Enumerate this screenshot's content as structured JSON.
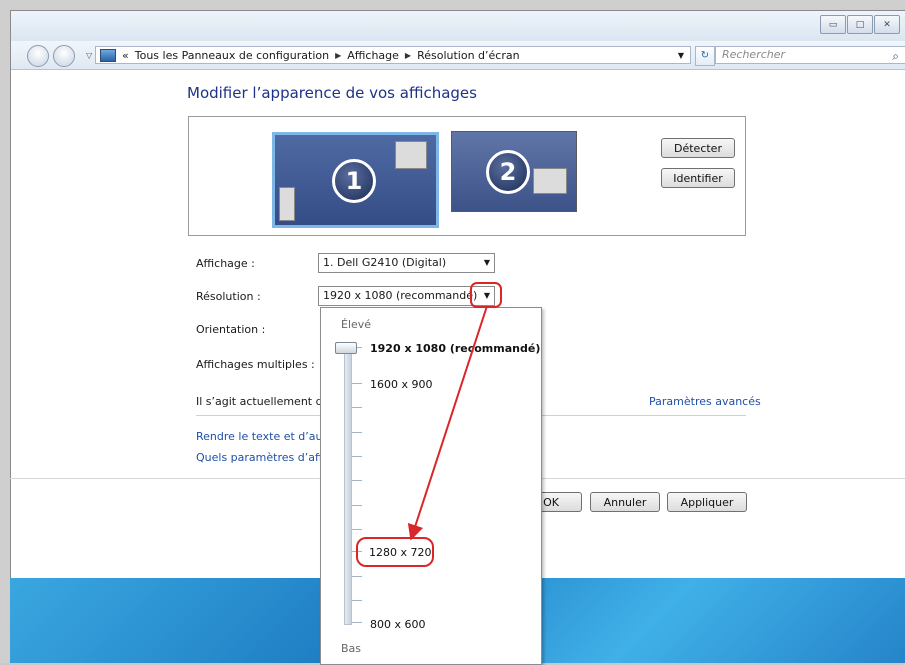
{
  "window": {
    "controls": [
      "minimize",
      "maximize",
      "close"
    ]
  },
  "address": {
    "prefix": "«",
    "crumbs": [
      "Tous les Panneaux de configuration",
      "Affichage",
      "Résolution d’écran"
    ],
    "search_placeholder": "Rechercher"
  },
  "main": {
    "heading": "Modifier l’apparence de vos affichages",
    "monitor1": "1",
    "monitor2": "2",
    "detect_label": "Détecter",
    "identify_label": "Identifier",
    "display_label": "Affichage :",
    "display_value": "1. Dell G2410 (Digital)",
    "resolution_label": "Résolution :",
    "resolution_value": "1920 x 1080 (recommandé)",
    "orientation_label": "Orientation :",
    "multiple_label": "Affichages multiples :",
    "status_text": "Il s’agit actuellement de",
    "advanced_link": "Paramètres avancés",
    "link1": "Rendre le texte et d’autr",
    "link2": "Quels paramètres d’affic",
    "ok_label": "OK",
    "cancel_label": "Annuler",
    "apply_label": "Appliquer"
  },
  "dropdown": {
    "top_label": "Élevé",
    "bottom_label": "Bas",
    "options": {
      "r1920": "1920 x 1080 (recommandé)",
      "r1600": "1600 x 900",
      "r1280": "1280 x 720",
      "r800": "800 x 600"
    },
    "slider_position": "1920 x 1080 (recommandé)"
  },
  "colors": {
    "annotation": "#d8262a",
    "heading": "#1e3287",
    "link": "#1f4fa7"
  }
}
